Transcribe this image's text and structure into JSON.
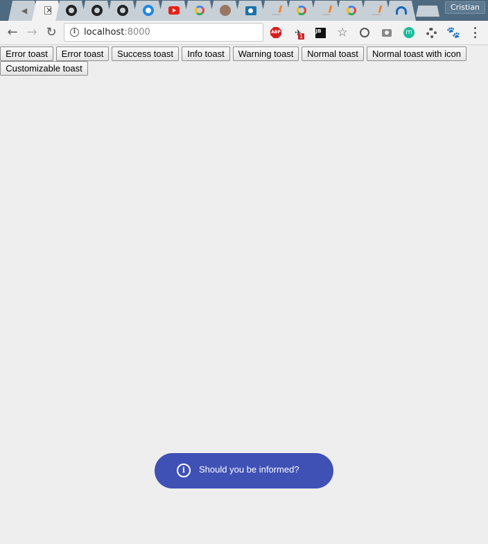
{
  "browser": {
    "tabs": [
      {
        "icon": "speaker-icon"
      },
      {
        "icon": "blank-page-icon",
        "active": true
      },
      {
        "icon": "github-icon"
      },
      {
        "icon": "github-icon"
      },
      {
        "icon": "github-icon"
      },
      {
        "icon": "blue-circle-icon"
      },
      {
        "icon": "youtube-icon"
      },
      {
        "icon": "google-icon"
      },
      {
        "icon": "avatar-face-icon"
      },
      {
        "icon": "camera-app-icon"
      },
      {
        "icon": "stackoverflow-icon"
      },
      {
        "icon": "google-icon"
      },
      {
        "icon": "stackoverflow-icon"
      },
      {
        "icon": "google-icon"
      },
      {
        "icon": "stackoverflow-icon"
      },
      {
        "icon": "arch-icon"
      }
    ],
    "tab_close_glyph": "✕",
    "profile_name": "Cristian",
    "address": {
      "host": "localhost",
      "port": ":8000",
      "info_glyph": "i"
    },
    "toolbar": {
      "back_glyph": "←",
      "forward_glyph": "→",
      "reload_glyph": "↻",
      "abp_text": "ABP",
      "badge_count": "1",
      "jb_text": "JB",
      "bookmark_glyph": "☆",
      "m_text": "m",
      "gnome_glyph": "🐾"
    }
  },
  "page": {
    "buttons": [
      "Error toast",
      "Error toast",
      "Success toast",
      "Info toast",
      "Warning toast",
      "Normal toast",
      "Normal toast with icon",
      "Customizable toast"
    ],
    "toast": {
      "message": "Should you be informed?",
      "icon_glyph": "i",
      "color": "#3f51b5"
    }
  }
}
